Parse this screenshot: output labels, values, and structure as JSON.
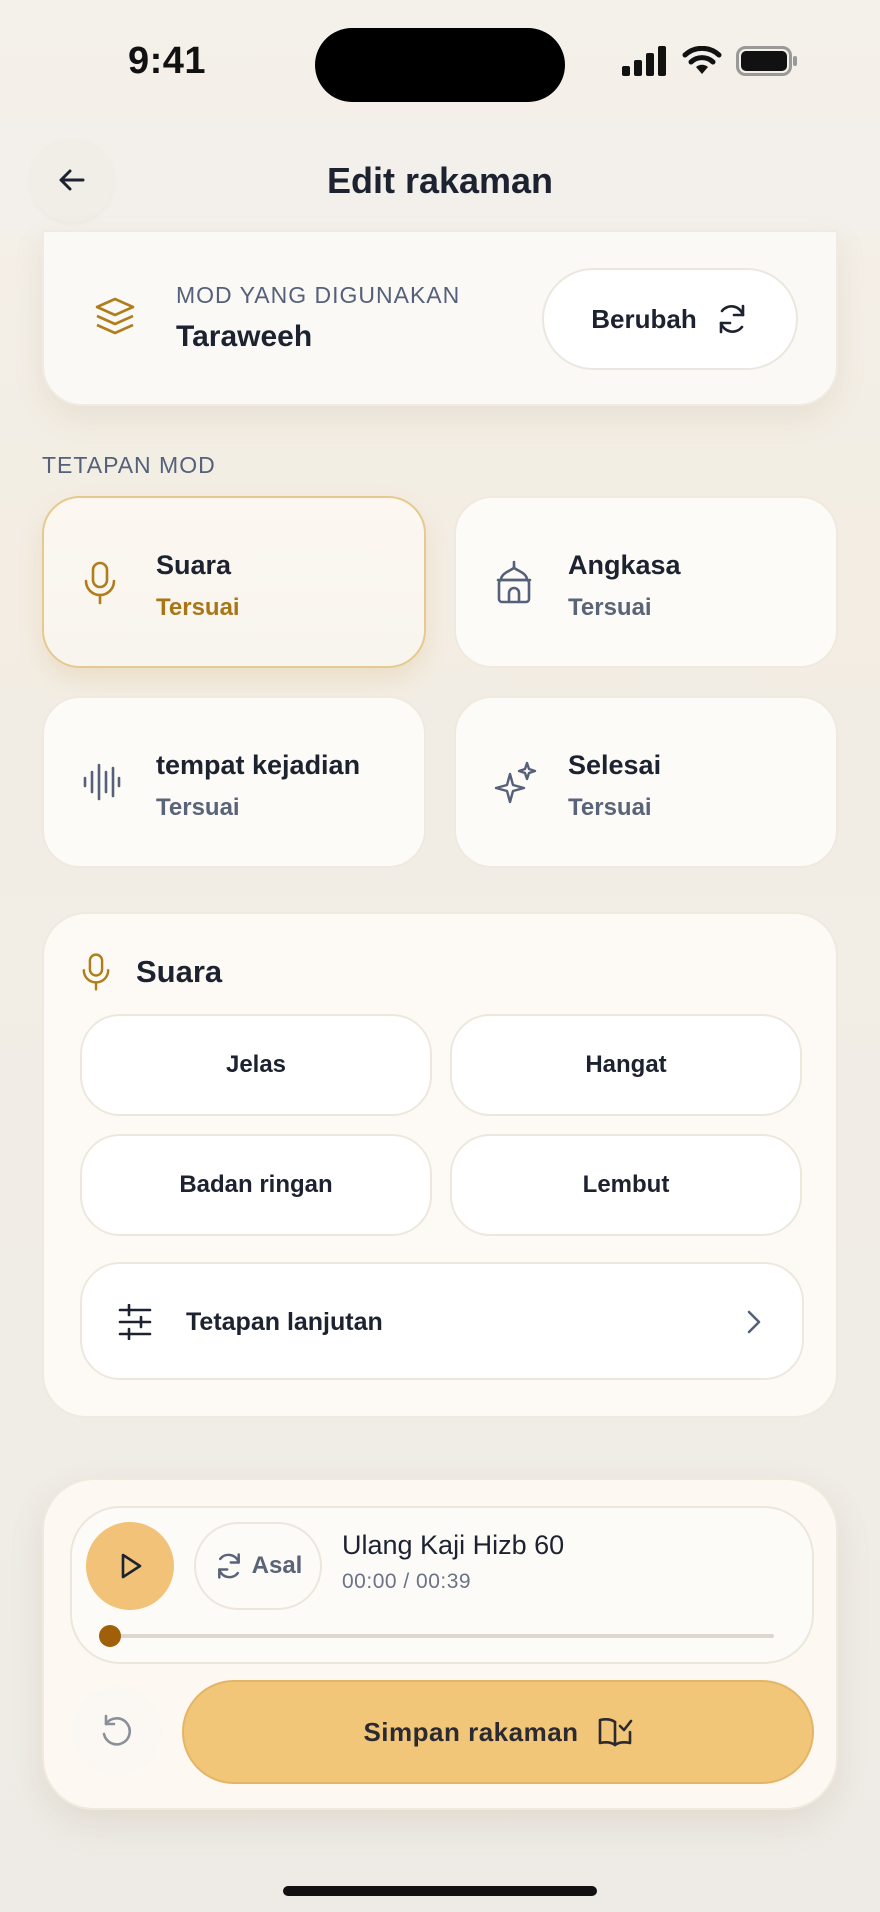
{
  "status_bar": {
    "time": "9:41"
  },
  "header": {
    "title": "Edit rakaman"
  },
  "mode": {
    "caption": "MOD YANG DIGUNAKAN",
    "value": "Taraweeh",
    "change_label": "Berubah"
  },
  "settings": {
    "section_label": "TETAPAN MOD",
    "tiles": [
      {
        "title": "Suara",
        "subtitle": "Tersuai",
        "icon": "microphone-icon",
        "selected": true
      },
      {
        "title": "Angkasa",
        "subtitle": "Tersuai",
        "icon": "mosque-icon",
        "selected": false
      },
      {
        "title": "tempat kejadian",
        "subtitle": "Tersuai",
        "icon": "waveform-icon",
        "selected": false
      },
      {
        "title": "Selesai",
        "subtitle": "Tersuai",
        "icon": "sparkles-icon",
        "selected": false
      }
    ]
  },
  "voice_panel": {
    "title": "Suara",
    "options": [
      "Jelas",
      "Hangat",
      "Badan ringan",
      "Lembut"
    ],
    "advanced_label": "Tetapan lanjutan"
  },
  "player": {
    "reset_label": "Asal",
    "track_title": "Ulang Kaji Hizb 60",
    "time": "00:00 / 00:39",
    "progress": 0.0,
    "save_label": "Simpan rakaman"
  },
  "colors": {
    "accent": "#f2c679",
    "accent_dark": "#a97615",
    "text": "#1c2230",
    "muted": "#5a6478"
  }
}
